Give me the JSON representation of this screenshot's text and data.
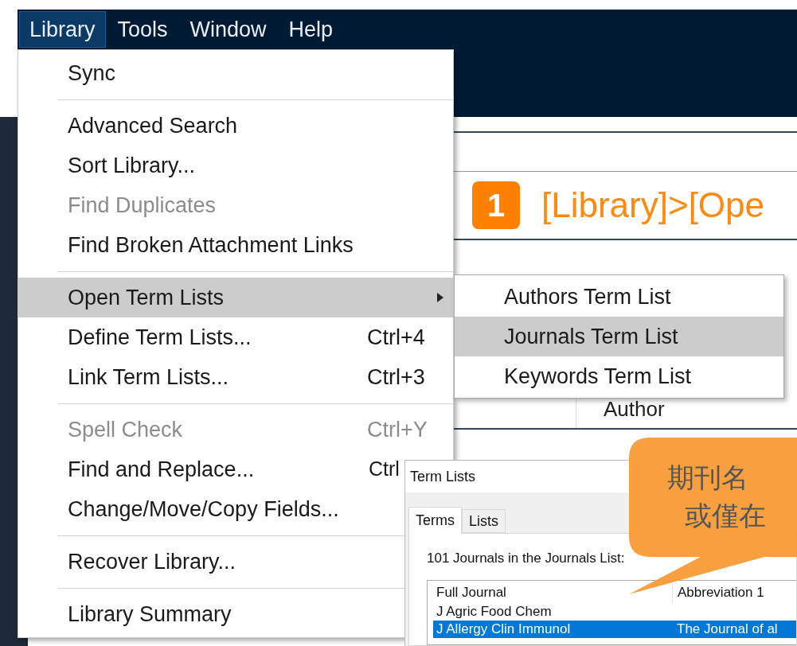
{
  "menubar": [
    {
      "label": "Library",
      "selected": true
    },
    {
      "label": "Tools",
      "selected": false
    },
    {
      "label": "Window",
      "selected": false
    },
    {
      "label": "Help",
      "selected": false
    }
  ],
  "menu": {
    "items": [
      {
        "kind": "item",
        "label": "Sync",
        "disabled": false,
        "highlighted": false
      },
      {
        "kind": "separator"
      },
      {
        "kind": "item",
        "label": "Advanced Search",
        "disabled": false,
        "highlighted": false
      },
      {
        "kind": "item",
        "label": "Sort Library...",
        "disabled": false,
        "highlighted": false
      },
      {
        "kind": "item",
        "label": "Find Duplicates",
        "disabled": true,
        "highlighted": false
      },
      {
        "kind": "item",
        "label": "Find Broken Attachment Links",
        "disabled": false,
        "highlighted": false
      },
      {
        "kind": "separator"
      },
      {
        "kind": "submenu",
        "label": "Open Term Lists",
        "disabled": false,
        "highlighted": true
      },
      {
        "kind": "item",
        "label": "Define Term Lists...",
        "shortcut": "Ctrl+4",
        "disabled": false,
        "highlighted": false
      },
      {
        "kind": "item",
        "label": "Link Term Lists...",
        "shortcut": "Ctrl+3",
        "disabled": false,
        "highlighted": false
      },
      {
        "kind": "separator"
      },
      {
        "kind": "item",
        "label": "Spell Check",
        "shortcut": "Ctrl+Y",
        "disabled": true,
        "highlighted": false
      },
      {
        "kind": "item",
        "label": "Find and Replace...",
        "shortcut": "Ctrl",
        "disabled": false,
        "highlighted": false
      },
      {
        "kind": "item",
        "label": "Change/Move/Copy Fields...",
        "disabled": false,
        "highlighted": false
      },
      {
        "kind": "separator"
      },
      {
        "kind": "item",
        "label": "Recover Library...",
        "disabled": false,
        "highlighted": false
      },
      {
        "kind": "separator"
      },
      {
        "kind": "item",
        "label": "Library Summary",
        "disabled": false,
        "highlighted": false
      }
    ]
  },
  "submenu": {
    "items": [
      {
        "label": "Authors Term List",
        "highlighted": false
      },
      {
        "label": "Journals Term List",
        "highlighted": true
      },
      {
        "label": "Keywords Term List",
        "highlighted": false
      }
    ]
  },
  "document": {
    "step_number": "1",
    "heading": "[Library]>[Ope",
    "column_label": "Author"
  },
  "callout": {
    "lines": [
      "期刊名",
      "或僅在"
    ]
  },
  "dialog": {
    "title": "Term Lists",
    "tabs": [
      {
        "label": "Terms",
        "selected": true
      },
      {
        "label": "Lists",
        "selected": false
      }
    ],
    "count_label": "101 Journals in the Journals List:",
    "table": {
      "columns": [
        "Full Journal",
        "Abbreviation 1"
      ],
      "rows": [
        {
          "full_journal": "J Agric Food Chem",
          "selected": false
        },
        {
          "full_journal": "J Allergy Clin Immunol",
          "abbreviation_1": "The Journal of al",
          "selected": true
        }
      ]
    }
  }
}
